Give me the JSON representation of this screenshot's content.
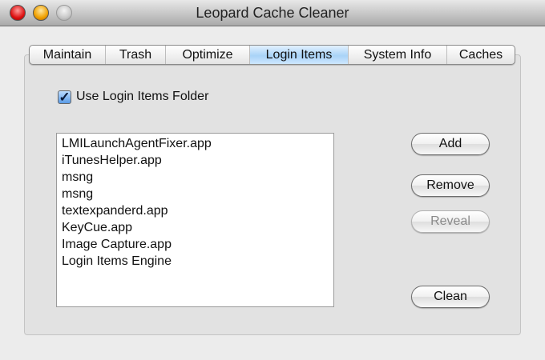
{
  "window": {
    "title": "Leopard Cache Cleaner"
  },
  "tabs": [
    {
      "label": "Maintain"
    },
    {
      "label": "Trash"
    },
    {
      "label": "Optimize"
    },
    {
      "label": "Login Items"
    },
    {
      "label": "System Info"
    },
    {
      "label": "Caches"
    }
  ],
  "active_tab": "Login Items",
  "checkbox": {
    "label": "Use Login Items Folder",
    "checked": true,
    "mark": "✓"
  },
  "login_items": [
    "LMILaunchAgentFixer.app",
    "iTunesHelper.app",
    "msng",
    "msng",
    "textexpanderd.app",
    "KeyCue.app",
    "Image Capture.app",
    "Login Items Engine"
  ],
  "buttons": {
    "add": "Add",
    "remove": "Remove",
    "reveal": "Reveal",
    "clean": "Clean"
  }
}
